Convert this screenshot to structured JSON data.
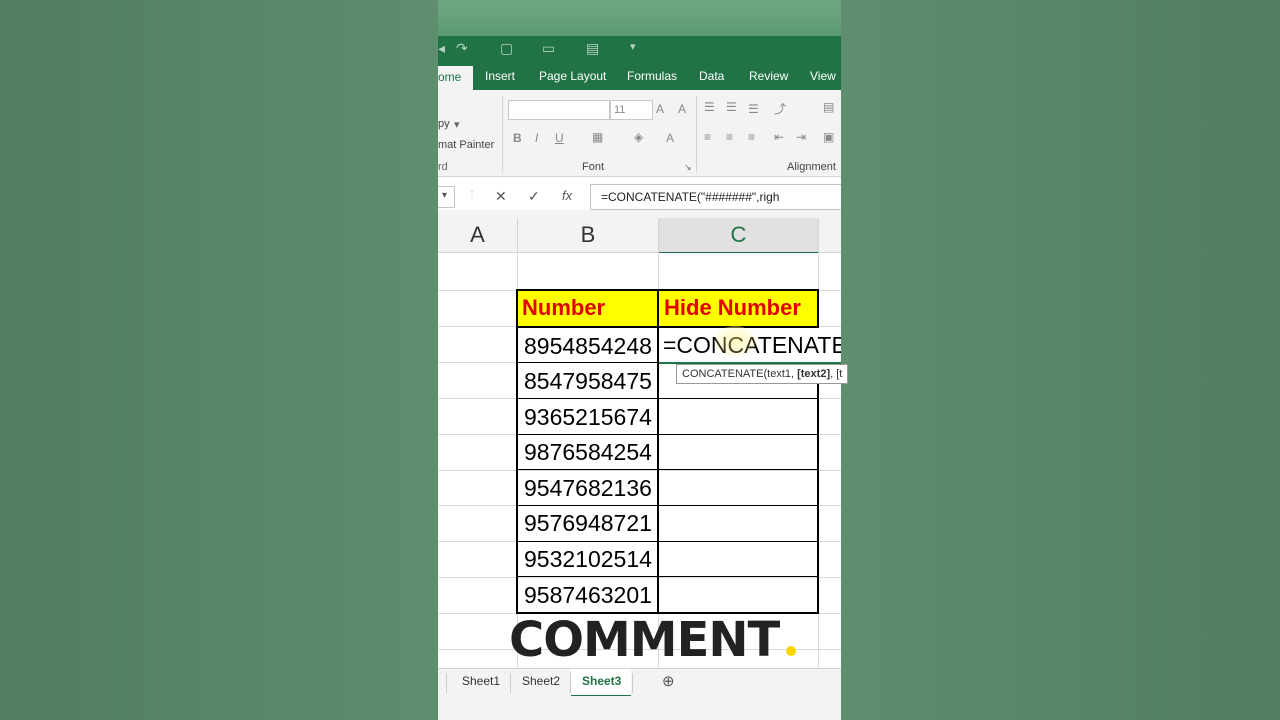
{
  "ribbon_tabs": [
    "ome",
    "Insert",
    "Page Layout",
    "Formulas",
    "Data",
    "Review",
    "View"
  ],
  "ribbon": {
    "clipboard_copy": "py",
    "clipboard_format_painter": "mat Painter",
    "clipboard_group_label": "rd",
    "font_size": "11",
    "font_group_label": "Font",
    "alignment_group_label": "Alignment",
    "bold": "B",
    "italic": "I",
    "underline": "U",
    "grow_font": "A",
    "font_color": "A"
  },
  "formula_bar": {
    "cancel": "✕",
    "enter": "✓",
    "fx": "fx",
    "formula": "=CONCATENATE(\"#######\",righ"
  },
  "columns": [
    "A",
    "B",
    "C"
  ],
  "table": {
    "header_number": "Number",
    "header_hide": "Hide Number",
    "numbers": [
      "8954854248",
      "8547958475",
      "9365215674",
      "9876584254",
      "9547682136",
      "9576948721",
      "9532102514",
      "9587463201"
    ],
    "editing_cell": "=CONCATENATE("
  },
  "tooltip": {
    "func": "CONCATENATE(text1, ",
    "bold_arg": "[text2]",
    "rest": ", [t"
  },
  "overlay": {
    "comment": "COMMENT"
  },
  "sheets": [
    "Sheet1",
    "Sheet2",
    "Sheet3"
  ],
  "active_sheet": "Sheet3",
  "colors": {
    "excel_green": "#217346",
    "header_fill": "#ffff00",
    "header_text": "#e00000"
  }
}
